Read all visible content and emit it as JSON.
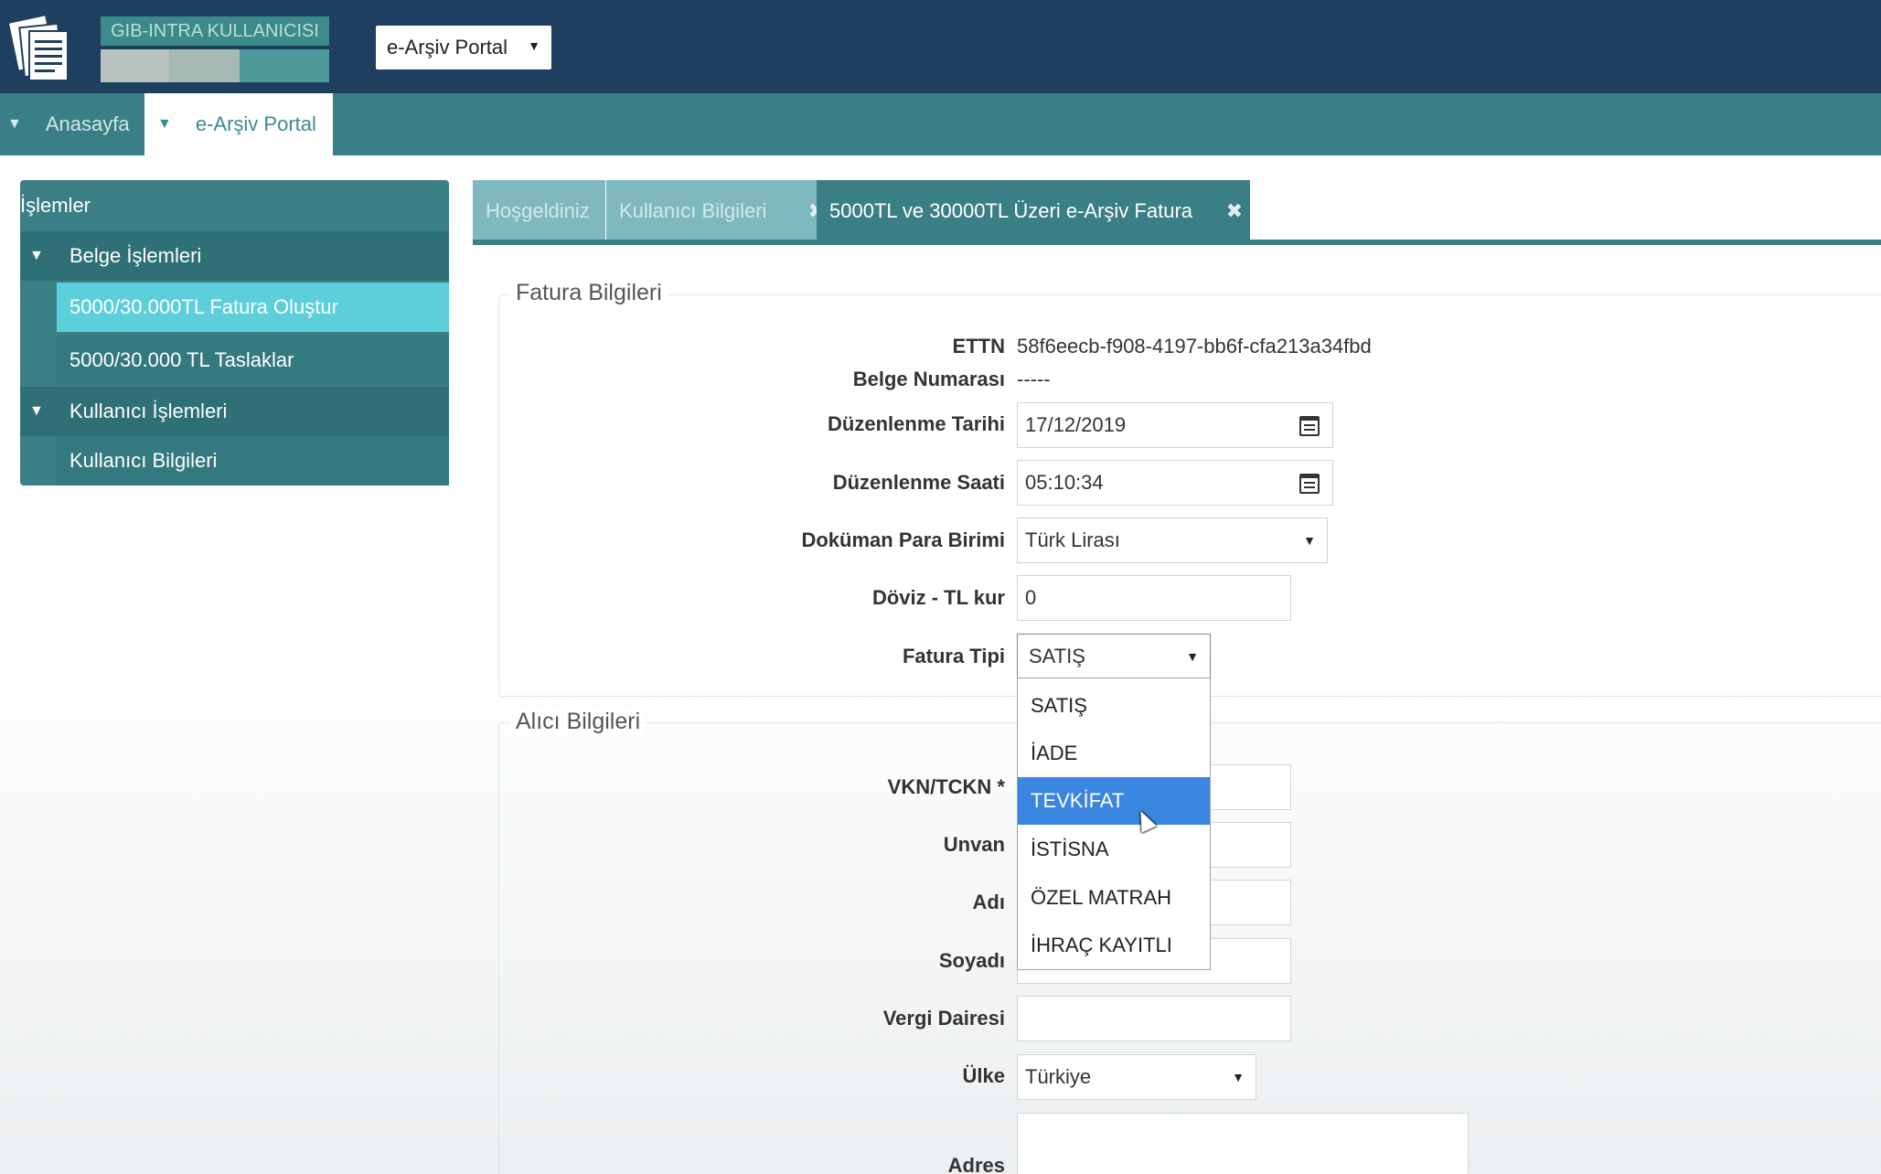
{
  "header": {
    "user_label": "GIB-INTRA KULLANICISI",
    "portal_select": "e-Arşiv Portal"
  },
  "nav": {
    "home": "Anasayfa",
    "portal": "e-Arşiv Portal"
  },
  "sidebar": {
    "title": "İşlemler",
    "groups": [
      {
        "label": "Belge İşlemleri",
        "items": [
          "5000/30.000TL Fatura Oluştur",
          "5000/30.000 TL Taslaklar"
        ]
      },
      {
        "label": "Kullanıcı İşlemleri",
        "items": [
          "Kullanıcı Bilgileri"
        ]
      }
    ],
    "active_item": "5000/30.000TL Fatura Oluştur"
  },
  "tabs": [
    {
      "label": "Hoşgeldiniz"
    },
    {
      "label": "Kullanıcı Bilgileri"
    },
    {
      "label": "5000TL ve 30000TL Üzeri e-Arşiv Fatura"
    }
  ],
  "fatura": {
    "legend": "Fatura Bilgileri",
    "ettn_label": "ETTN",
    "ettn_value": "58f6eecb-f908-4197-bb6f-cfa213a34fbd",
    "belge_label": "Belge Numarası",
    "belge_value": "-----",
    "tarih_label": "Düzenlenme Tarihi",
    "tarih_value": "17/12/2019",
    "saat_label": "Düzenlenme Saati",
    "saat_value": "05:10:34",
    "para_label": "Doküman Para Birimi",
    "para_value": "Türk Lirası",
    "kur_label": "Döviz - TL kur",
    "kur_value": "0",
    "tip_label": "Fatura Tipi",
    "tip_value": "SATIŞ"
  },
  "fatura_tipi_options": [
    "SATIŞ",
    "İADE",
    "TEVKİFAT",
    "İSTİSNA",
    "ÖZEL MATRAH",
    "İHRAÇ KAYITLI"
  ],
  "fatura_tipi_highlighted": "TEVKİFAT",
  "alici": {
    "legend": "Alıcı Bilgileri",
    "vkn_label": "VKN/TCKN *",
    "unvan_label": "Unvan",
    "adi_label": "Adı",
    "soyadi_label": "Soyadı",
    "vergi_label": "Vergi Dairesi",
    "ulke_label": "Ülke",
    "ulke_value": "Türkiye",
    "adres_label": "Adres"
  },
  "colors": {
    "topbar": "#1e3f5f",
    "teal": "#3b7f86",
    "active_item": "#5ccfdb",
    "highlight": "#3b86e0"
  }
}
